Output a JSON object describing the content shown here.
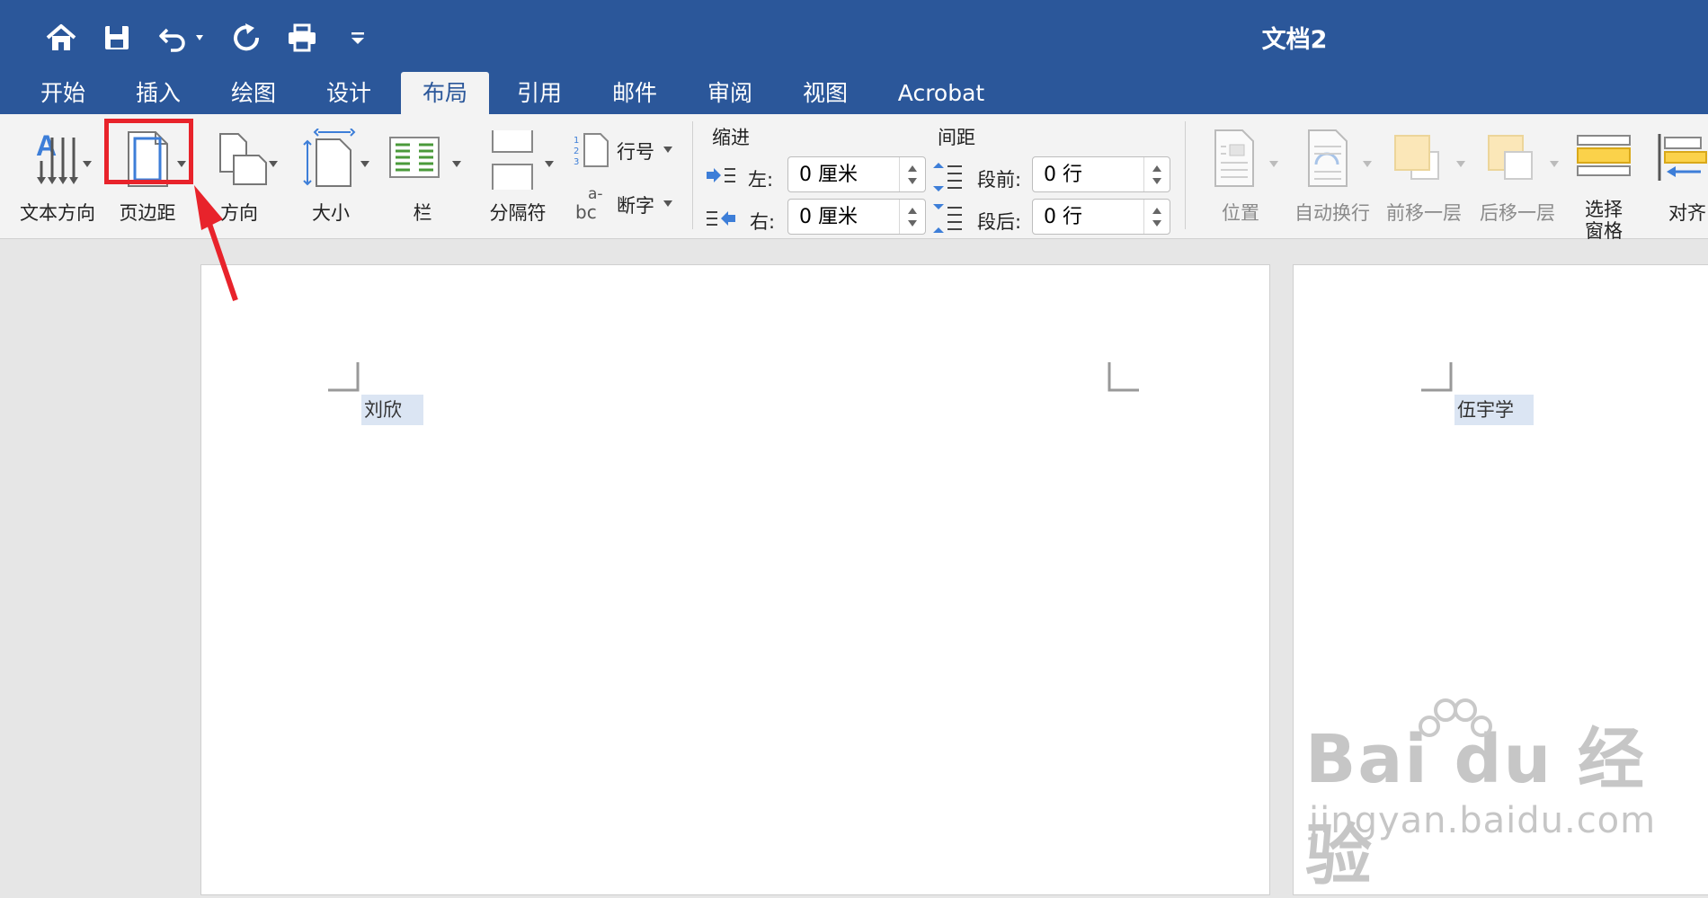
{
  "window": {
    "title": "文档2"
  },
  "quick_access": [
    {
      "icon": "home-icon"
    },
    {
      "icon": "save-icon"
    },
    {
      "icon": "undo-icon"
    },
    {
      "icon": "redo-icon"
    },
    {
      "icon": "print-icon"
    },
    {
      "icon": "customize-qat-icon"
    }
  ],
  "tabs": [
    {
      "label": "开始"
    },
    {
      "label": "插入"
    },
    {
      "label": "绘图"
    },
    {
      "label": "设计"
    },
    {
      "label": "布局",
      "active": true
    },
    {
      "label": "引用"
    },
    {
      "label": "邮件"
    },
    {
      "label": "审阅"
    },
    {
      "label": "视图"
    },
    {
      "label": "Acrobat"
    }
  ],
  "ribbon": {
    "text_direction": "文本方向",
    "margins": "页边距",
    "orientation": "方向",
    "size": "大小",
    "columns": "栏",
    "breaks": "分隔符",
    "line_numbers": "行号",
    "hyphenation": "断字",
    "indent": {
      "title": "缩进",
      "left_label": "左:",
      "left_value": "0 厘米",
      "right_label": "右:",
      "right_value": "0 厘米"
    },
    "spacing": {
      "title": "间距",
      "before_label": "段前:",
      "before_value": "0 行",
      "after_label": "段后:",
      "after_value": "0 行"
    },
    "position": "位置",
    "wrap_text": "自动换行",
    "bring_forward": "前移一层",
    "send_backward": "后移一层",
    "selection_pane_line1": "选择",
    "selection_pane_line2": "窗格",
    "align": "对齐"
  },
  "document": {
    "page1_text": "刘欣",
    "page2_text": "伍宇学"
  },
  "watermark": {
    "brand": "Bai du 经验",
    "url": "jingyan.baidu.com"
  },
  "colors": {
    "title_bar": "#2b579a",
    "ribbon_bg": "#f3f3f3",
    "highlight_box": "#e8232b",
    "annotation_arrow": "#e8232b"
  }
}
